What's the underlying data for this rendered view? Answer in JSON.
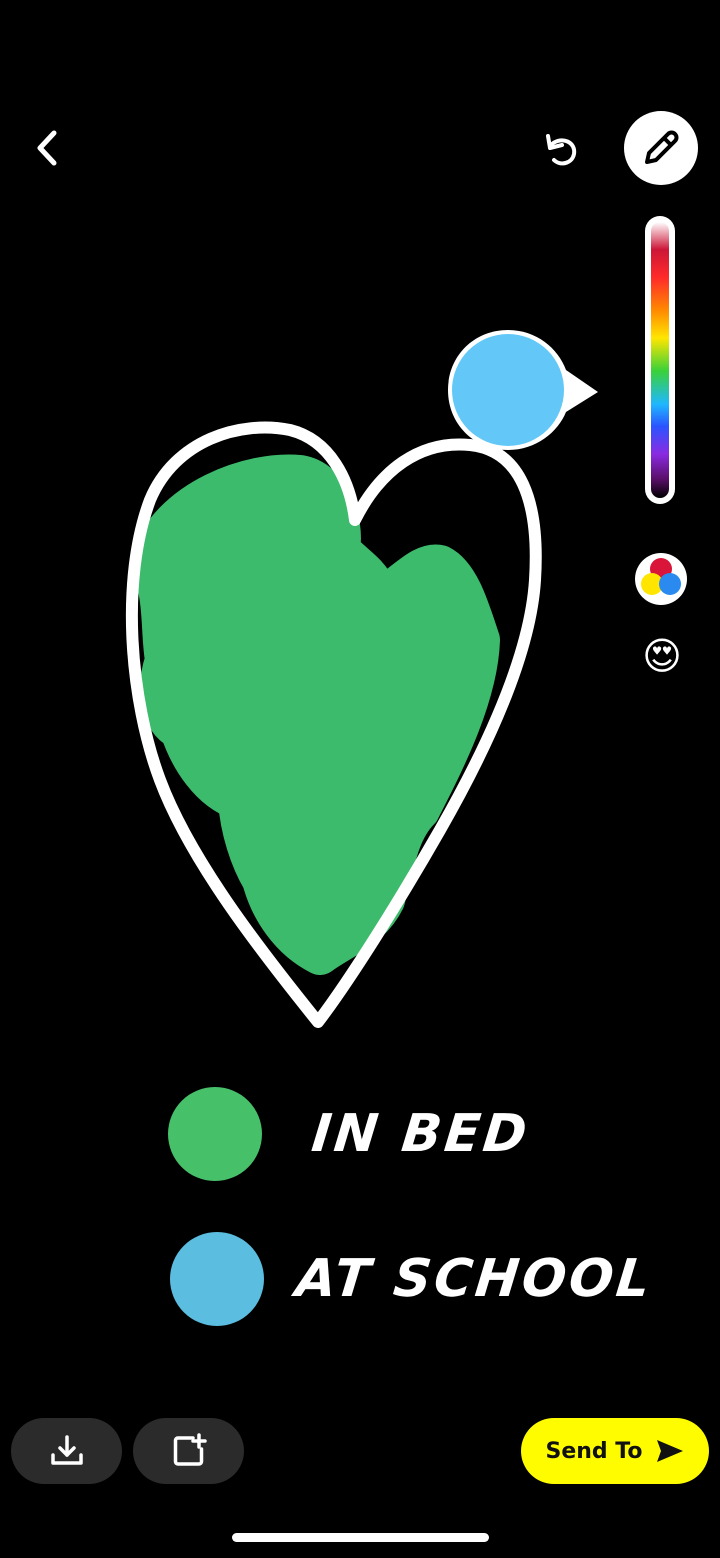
{
  "toolbar": {
    "back_icon": "chevron-left-icon",
    "undo_icon": "undo-icon",
    "pencil_icon": "pencil-icon",
    "color_mix_icon": "color-palette-icon",
    "emoji": "😍"
  },
  "drawing": {
    "heart_color": "#ffffff",
    "fill_color": "#3dbb6c",
    "selected_color": "#63c8f7"
  },
  "legend": [
    {
      "label": "IN BED",
      "color": "#47c06a"
    },
    {
      "label": "AT SCHOOL",
      "color": "#5bbde0"
    }
  ],
  "bottom": {
    "save_icon": "download-icon",
    "story_icon": "add-story-icon",
    "send_label": "Send To",
    "send_icon": "send-arrow-icon",
    "send_color": "#fffc00"
  }
}
